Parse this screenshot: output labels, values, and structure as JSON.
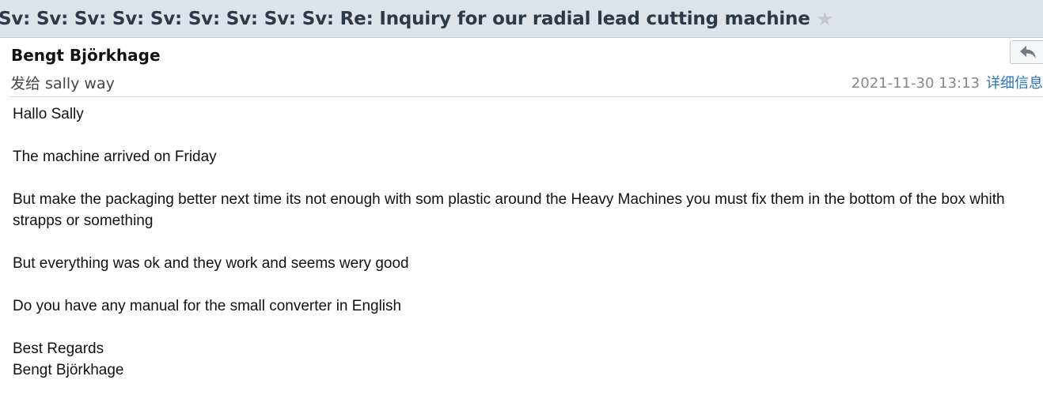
{
  "email": {
    "subject": "Sv: Sv: Sv: Sv: Sv: Sv: Sv: Sv: Sv: Re: Inquiry for our radial lead cutting machine",
    "star_icon": "star-icon",
    "sender": "Bengt Björkhage",
    "recipient_line": "发给 sally way",
    "datetime": "2021-11-30 13:13",
    "details_label": "详细信息",
    "reply_icon": "reply-arrow-icon",
    "body": {
      "p1": "Hallo Sally",
      "p2": "The machine arrived on Friday",
      "p3": "But make the packaging better next time its not enough with som plastic around the Heavy Machines you must fix them in the bottom of the box whith strapps or something",
      "p4": "But everything was ok and they work and seems wery good",
      "p5": "Do you have any manual for the small converter in English",
      "signoff_line1": "Best Regards",
      "signoff_line2": "Bengt Björkhage"
    }
  },
  "colors": {
    "subject_bar_bg": "#dde3e9",
    "link": "#2a72c5",
    "star": "#c4c8cc"
  }
}
